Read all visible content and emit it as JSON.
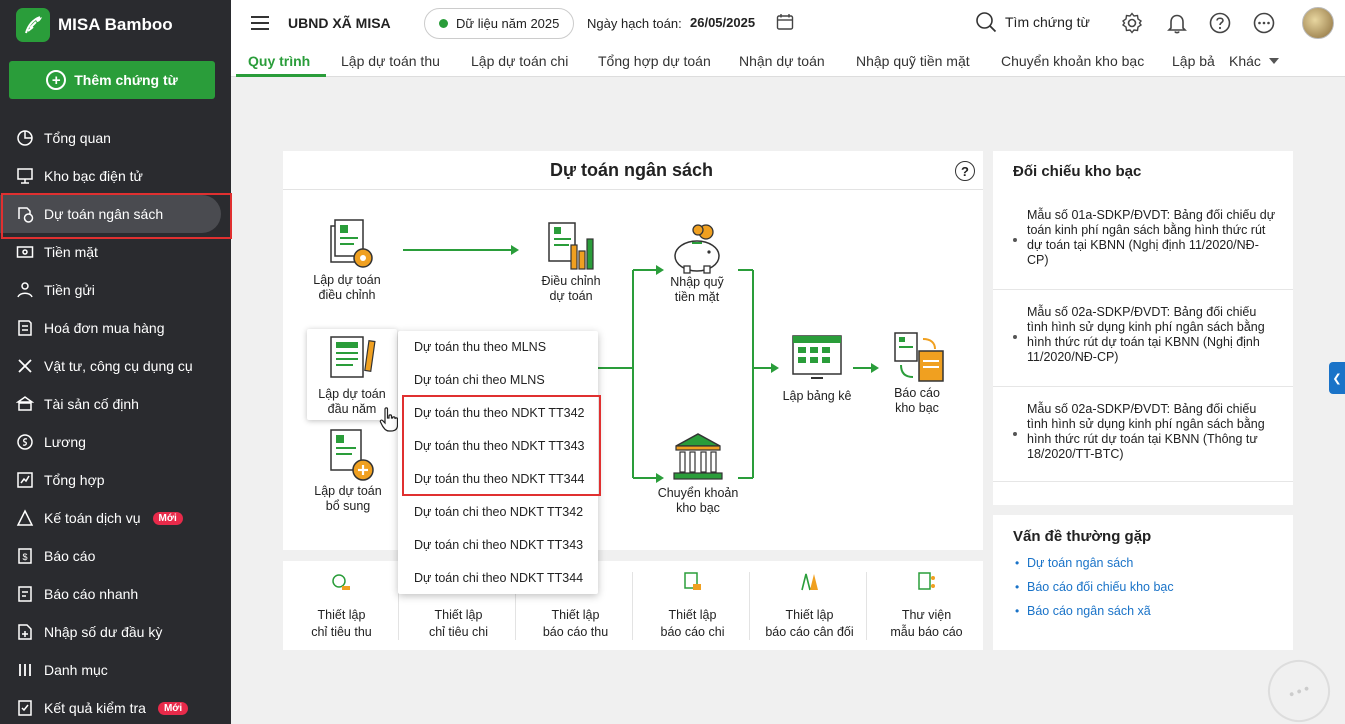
{
  "app": {
    "name": "MISA Bamboo",
    "add_button": "Thêm chứng từ"
  },
  "sidebar": {
    "items": [
      {
        "label": "Tổng quan",
        "icon": "pie-chart-icon"
      },
      {
        "label": "Kho bạc điện tử",
        "icon": "monitor-icon"
      },
      {
        "label": "Dự toán ngân sách",
        "icon": "budget-icon",
        "active": true
      },
      {
        "label": "Tiền mặt",
        "icon": "cash-icon"
      },
      {
        "label": "Tiền gửi",
        "icon": "deposit-icon"
      },
      {
        "label": "Hoá đơn mua hàng",
        "icon": "invoice-icon"
      },
      {
        "label": "Vật tư, công cụ dụng cụ",
        "icon": "tools-icon"
      },
      {
        "label": "Tài sản cố định",
        "icon": "bank-icon"
      },
      {
        "label": "Lương",
        "icon": "salary-icon"
      },
      {
        "label": "Tổng hợp",
        "icon": "summary-icon"
      },
      {
        "label": "Kế toán dịch vụ",
        "icon": "service-icon",
        "badge": "Mới"
      },
      {
        "label": "Báo cáo",
        "icon": "report-icon"
      },
      {
        "label": "Báo cáo nhanh",
        "icon": "quick-report-icon"
      },
      {
        "label": "Nhập số dư đầu kỳ",
        "icon": "opening-balance-icon"
      },
      {
        "label": "Danh mục",
        "icon": "catalog-icon"
      },
      {
        "label": "Kết quả kiểm tra",
        "icon": "check-result-icon",
        "badge": "Mới"
      }
    ]
  },
  "topbar": {
    "org": "UBND XÃ MISA",
    "year": "Dữ liệu năm 2025",
    "date_label": "Ngày hạch toán:",
    "date_value": "26/05/2025",
    "search": "Tìm chứng từ"
  },
  "tabs": [
    "Quy trình",
    "Lập dự toán thu",
    "Lập dự toán chi",
    "Tổng hợp dự toán",
    "Nhận dự toán",
    "Nhập quỹ tiền mặt",
    "Chuyển khoản kho bạc",
    "Lập bả",
    "Khác"
  ],
  "main": {
    "title": "Dự toán ngân sách",
    "flow": {
      "adjust_plan": "Lập dự toán\nđiều chỉnh",
      "adjust": "Điều chỉnh\ndự toán",
      "cash_in": "Nhập quỹ\ntiền mặt",
      "annual": "Lập dự toán\nđầu năm",
      "statement": "Lập bảng kê",
      "treasury_report": "Báo cáo\nkho bạc",
      "supplement": "Lập dự toán\nbổ sung",
      "transfer": "Chuyển khoản\nkho bạc"
    },
    "dropdown": [
      "Dự toán thu theo MLNS",
      "Dự toán chi theo MLNS",
      "Dự toán thu theo NDKT TT342",
      "Dự toán thu theo NDKT TT343",
      "Dự toán thu theo NDKT TT344",
      "Dự toán chi theo NDKT TT342",
      "Dự toán chi theo NDKT TT343",
      "Dự toán chi theo NDKT TT344"
    ],
    "bottom": [
      "Thiết lập\nchỉ tiêu thu",
      "Thiết lập\nchỉ tiêu chi",
      "Thiết lập\nbáo cáo thu",
      "Thiết lập\nbáo cáo chi",
      "Thiết lập\nbáo cáo cân đối",
      "Thư viện\nmẫu báo cáo"
    ]
  },
  "right": {
    "recon_title": "Đối chiếu kho bạc",
    "recon_items": [
      "Mẫu số 01a-SDKP/ĐVDT: Bảng đối chiếu dự toán kinh phí ngân sách bằng hình thức rút dự toán tại KBNN (Nghị định 11/2020/NĐ-CP)",
      "Mẫu số 02a-SDKP/ĐVDT: Bảng đối chiếu tình hình sử dụng kinh phí ngân sách bằng hình thức rút dự toán tại KBNN (Nghị định 11/2020/NĐ-CP)",
      "Mẫu số 02a-SDKP/ĐVDT: Bảng đối chiếu tình hình sử dụng kinh phí ngân sách bằng hình thức rút dự toán tại KBNN (Thông tư 18/2020/TT-BTC)"
    ],
    "faq_title": "Vấn đề thường gặp",
    "faq_links": [
      "Dự toán ngân sách",
      "Báo cáo đối chiếu kho bạc",
      "Báo cáo ngân sách xã"
    ]
  },
  "colors": {
    "brand": "#2a9d3a",
    "sidebar": "#2a2b2f",
    "highlight": "#e03030",
    "link": "#1a73c8"
  }
}
